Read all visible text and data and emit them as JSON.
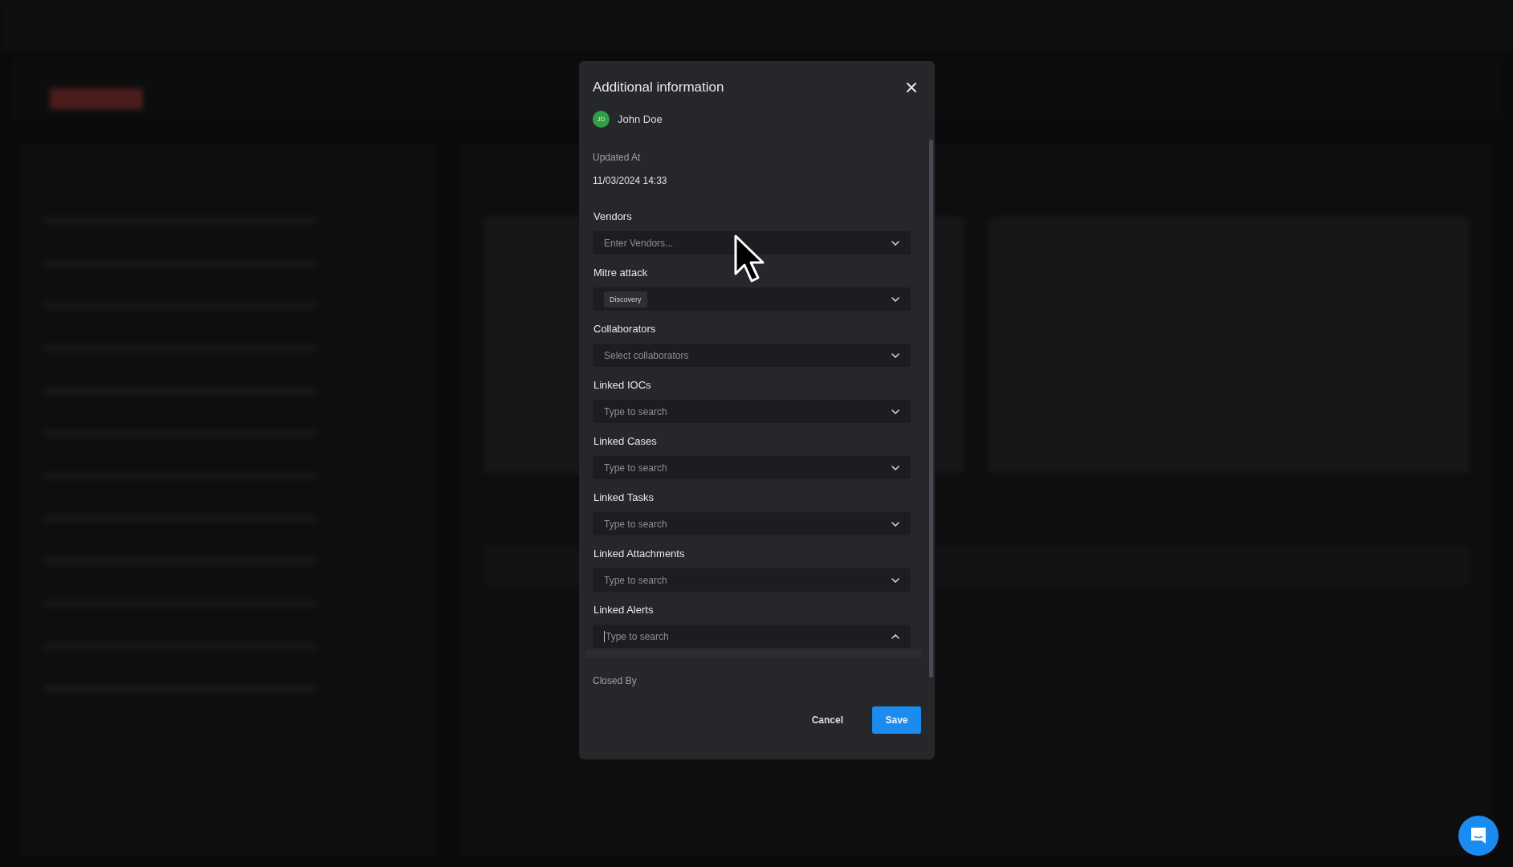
{
  "dialog": {
    "title": "Additional information",
    "user": {
      "initials": "JD",
      "name": "John Doe"
    },
    "updated": {
      "label": "Updated At",
      "value": "11/03/2024 14:33"
    },
    "fields": [
      {
        "label": "Vendors",
        "placeholder": "Enter Vendors...",
        "expanded": false
      },
      {
        "label": "Mitre attack",
        "tags": [
          "Discovery"
        ],
        "expanded": false
      },
      {
        "label": "Collaborators",
        "placeholder": "Select collaborators",
        "expanded": false
      },
      {
        "label": "Linked IOCs",
        "placeholder": "Type to search",
        "expanded": false
      },
      {
        "label": "Linked Cases",
        "placeholder": "Type to search",
        "expanded": false
      },
      {
        "label": "Linked Tasks",
        "placeholder": "Type to search",
        "expanded": false
      },
      {
        "label": "Linked Attachments",
        "placeholder": "Type to search",
        "expanded": false
      },
      {
        "label": "Linked Alerts",
        "placeholder": "Type to search",
        "expanded": true
      }
    ],
    "closed_by_label": "Closed By",
    "buttons": [
      {
        "label": "Cancel",
        "kind": "text"
      },
      {
        "label": "Save",
        "kind": "primary"
      }
    ]
  }
}
